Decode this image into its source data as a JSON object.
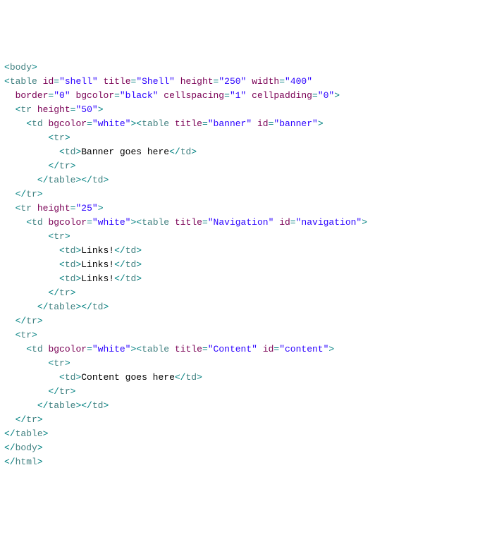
{
  "lines": [
    {
      "indent": 0,
      "parts": [
        {
          "t": "tag",
          "v": "<"
        },
        {
          "t": "elem",
          "v": "body"
        },
        {
          "t": "tag",
          "v": ">"
        }
      ]
    },
    {
      "indent": 0,
      "parts": [
        {
          "t": "tag",
          "v": "<"
        },
        {
          "t": "elem",
          "v": "table"
        },
        {
          "t": "text",
          "v": " "
        },
        {
          "t": "attr",
          "v": "id"
        },
        {
          "t": "tag",
          "v": "="
        },
        {
          "t": "val",
          "v": "\"shell\""
        },
        {
          "t": "text",
          "v": " "
        },
        {
          "t": "attr",
          "v": "title"
        },
        {
          "t": "tag",
          "v": "="
        },
        {
          "t": "val",
          "v": "\"Shell\""
        },
        {
          "t": "text",
          "v": " "
        },
        {
          "t": "attr",
          "v": "height"
        },
        {
          "t": "tag",
          "v": "="
        },
        {
          "t": "val",
          "v": "\"250\""
        },
        {
          "t": "text",
          "v": " "
        },
        {
          "t": "attr",
          "v": "width"
        },
        {
          "t": "tag",
          "v": "="
        },
        {
          "t": "val",
          "v": "\"400\""
        }
      ]
    },
    {
      "indent": 2,
      "parts": [
        {
          "t": "attr",
          "v": "border"
        },
        {
          "t": "tag",
          "v": "="
        },
        {
          "t": "val",
          "v": "\"0\""
        },
        {
          "t": "text",
          "v": " "
        },
        {
          "t": "attr",
          "v": "bgcolor"
        },
        {
          "t": "tag",
          "v": "="
        },
        {
          "t": "val",
          "v": "\"black\""
        },
        {
          "t": "text",
          "v": " "
        },
        {
          "t": "attr",
          "v": "cellspacing"
        },
        {
          "t": "tag",
          "v": "="
        },
        {
          "t": "val",
          "v": "\"1\""
        },
        {
          "t": "text",
          "v": " "
        },
        {
          "t": "attr",
          "v": "cellpadding"
        },
        {
          "t": "tag",
          "v": "="
        },
        {
          "t": "val",
          "v": "\"0\""
        },
        {
          "t": "tag",
          "v": ">"
        }
      ]
    },
    {
      "indent": 2,
      "parts": [
        {
          "t": "tag",
          "v": "<"
        },
        {
          "t": "elem",
          "v": "tr"
        },
        {
          "t": "text",
          "v": " "
        },
        {
          "t": "attr",
          "v": "height"
        },
        {
          "t": "tag",
          "v": "="
        },
        {
          "t": "val",
          "v": "\"50\""
        },
        {
          "t": "tag",
          "v": ">"
        }
      ]
    },
    {
      "indent": 4,
      "parts": [
        {
          "t": "tag",
          "v": "<"
        },
        {
          "t": "elem",
          "v": "td"
        },
        {
          "t": "text",
          "v": " "
        },
        {
          "t": "attr",
          "v": "bgcolor"
        },
        {
          "t": "tag",
          "v": "="
        },
        {
          "t": "val",
          "v": "\"white\""
        },
        {
          "t": "tag",
          "v": "><"
        },
        {
          "t": "elem",
          "v": "table"
        },
        {
          "t": "text",
          "v": " "
        },
        {
          "t": "attr",
          "v": "title"
        },
        {
          "t": "tag",
          "v": "="
        },
        {
          "t": "val",
          "v": "\"banner\""
        },
        {
          "t": "text",
          "v": " "
        },
        {
          "t": "attr",
          "v": "id"
        },
        {
          "t": "tag",
          "v": "="
        },
        {
          "t": "val",
          "v": "\"banner\""
        },
        {
          "t": "tag",
          "v": ">"
        }
      ]
    },
    {
      "indent": 8,
      "parts": [
        {
          "t": "tag",
          "v": "<"
        },
        {
          "t": "elem",
          "v": "tr"
        },
        {
          "t": "tag",
          "v": ">"
        }
      ]
    },
    {
      "indent": 10,
      "parts": [
        {
          "t": "tag",
          "v": "<"
        },
        {
          "t": "elem",
          "v": "td"
        },
        {
          "t": "tag",
          "v": ">"
        },
        {
          "t": "text",
          "v": "Banner goes here"
        },
        {
          "t": "tag",
          "v": "</"
        },
        {
          "t": "elem",
          "v": "td"
        },
        {
          "t": "tag",
          "v": ">"
        }
      ]
    },
    {
      "indent": 8,
      "parts": [
        {
          "t": "tag",
          "v": "</"
        },
        {
          "t": "elem",
          "v": "tr"
        },
        {
          "t": "tag",
          "v": ">"
        }
      ]
    },
    {
      "indent": 6,
      "parts": [
        {
          "t": "tag",
          "v": "</"
        },
        {
          "t": "elem",
          "v": "table"
        },
        {
          "t": "tag",
          "v": "></"
        },
        {
          "t": "elem",
          "v": "td"
        },
        {
          "t": "tag",
          "v": ">"
        }
      ]
    },
    {
      "indent": 2,
      "parts": [
        {
          "t": "tag",
          "v": "</"
        },
        {
          "t": "elem",
          "v": "tr"
        },
        {
          "t": "tag",
          "v": ">"
        }
      ]
    },
    {
      "indent": 2,
      "parts": [
        {
          "t": "tag",
          "v": "<"
        },
        {
          "t": "elem",
          "v": "tr"
        },
        {
          "t": "text",
          "v": " "
        },
        {
          "t": "attr",
          "v": "height"
        },
        {
          "t": "tag",
          "v": "="
        },
        {
          "t": "val",
          "v": "\"25\""
        },
        {
          "t": "tag",
          "v": ">"
        }
      ]
    },
    {
      "indent": 4,
      "parts": [
        {
          "t": "tag",
          "v": "<"
        },
        {
          "t": "elem",
          "v": "td"
        },
        {
          "t": "text",
          "v": " "
        },
        {
          "t": "attr",
          "v": "bgcolor"
        },
        {
          "t": "tag",
          "v": "="
        },
        {
          "t": "val",
          "v": "\"white\""
        },
        {
          "t": "tag",
          "v": "><"
        },
        {
          "t": "elem",
          "v": "table"
        },
        {
          "t": "text",
          "v": " "
        },
        {
          "t": "attr",
          "v": "title"
        },
        {
          "t": "tag",
          "v": "="
        },
        {
          "t": "val",
          "v": "\"Navigation\""
        },
        {
          "t": "text",
          "v": " "
        },
        {
          "t": "attr",
          "v": "id"
        },
        {
          "t": "tag",
          "v": "="
        },
        {
          "t": "val",
          "v": "\"navigation\""
        },
        {
          "t": "tag",
          "v": ">"
        }
      ]
    },
    {
      "indent": 8,
      "parts": [
        {
          "t": "tag",
          "v": "<"
        },
        {
          "t": "elem",
          "v": "tr"
        },
        {
          "t": "tag",
          "v": ">"
        }
      ]
    },
    {
      "indent": 10,
      "parts": [
        {
          "t": "tag",
          "v": "<"
        },
        {
          "t": "elem",
          "v": "td"
        },
        {
          "t": "tag",
          "v": ">"
        },
        {
          "t": "text",
          "v": "Links!"
        },
        {
          "t": "tag",
          "v": "</"
        },
        {
          "t": "elem",
          "v": "td"
        },
        {
          "t": "tag",
          "v": ">"
        }
      ]
    },
    {
      "indent": 10,
      "parts": [
        {
          "t": "tag",
          "v": "<"
        },
        {
          "t": "elem",
          "v": "td"
        },
        {
          "t": "tag",
          "v": ">"
        },
        {
          "t": "text",
          "v": "Links!"
        },
        {
          "t": "tag",
          "v": "</"
        },
        {
          "t": "elem",
          "v": "td"
        },
        {
          "t": "tag",
          "v": ">"
        }
      ]
    },
    {
      "indent": 10,
      "parts": [
        {
          "t": "tag",
          "v": "<"
        },
        {
          "t": "elem",
          "v": "td"
        },
        {
          "t": "tag",
          "v": ">"
        },
        {
          "t": "text",
          "v": "Links!"
        },
        {
          "t": "tag",
          "v": "</"
        },
        {
          "t": "elem",
          "v": "td"
        },
        {
          "t": "tag",
          "v": ">"
        }
      ]
    },
    {
      "indent": 8,
      "parts": [
        {
          "t": "tag",
          "v": "</"
        },
        {
          "t": "elem",
          "v": "tr"
        },
        {
          "t": "tag",
          "v": ">"
        }
      ]
    },
    {
      "indent": 6,
      "parts": [
        {
          "t": "tag",
          "v": "</"
        },
        {
          "t": "elem",
          "v": "table"
        },
        {
          "t": "tag",
          "v": "></"
        },
        {
          "t": "elem",
          "v": "td"
        },
        {
          "t": "tag",
          "v": ">"
        }
      ]
    },
    {
      "indent": 2,
      "parts": [
        {
          "t": "tag",
          "v": "</"
        },
        {
          "t": "elem",
          "v": "tr"
        },
        {
          "t": "tag",
          "v": ">"
        }
      ]
    },
    {
      "indent": 2,
      "parts": [
        {
          "t": "tag",
          "v": "<"
        },
        {
          "t": "elem",
          "v": "tr"
        },
        {
          "t": "tag",
          "v": ">"
        }
      ]
    },
    {
      "indent": 4,
      "parts": [
        {
          "t": "tag",
          "v": "<"
        },
        {
          "t": "elem",
          "v": "td"
        },
        {
          "t": "text",
          "v": " "
        },
        {
          "t": "attr",
          "v": "bgcolor"
        },
        {
          "t": "tag",
          "v": "="
        },
        {
          "t": "val",
          "v": "\"white\""
        },
        {
          "t": "tag",
          "v": "><"
        },
        {
          "t": "elem",
          "v": "table"
        },
        {
          "t": "text",
          "v": " "
        },
        {
          "t": "attr",
          "v": "title"
        },
        {
          "t": "tag",
          "v": "="
        },
        {
          "t": "val",
          "v": "\"Content\""
        },
        {
          "t": "text",
          "v": " "
        },
        {
          "t": "attr",
          "v": "id"
        },
        {
          "t": "tag",
          "v": "="
        },
        {
          "t": "val",
          "v": "\"content\""
        },
        {
          "t": "tag",
          "v": ">"
        }
      ]
    },
    {
      "indent": 8,
      "parts": [
        {
          "t": "tag",
          "v": "<"
        },
        {
          "t": "elem",
          "v": "tr"
        },
        {
          "t": "tag",
          "v": ">"
        }
      ]
    },
    {
      "indent": 10,
      "parts": [
        {
          "t": "tag",
          "v": "<"
        },
        {
          "t": "elem",
          "v": "td"
        },
        {
          "t": "tag",
          "v": ">"
        },
        {
          "t": "text",
          "v": "Content goes here"
        },
        {
          "t": "tag",
          "v": "</"
        },
        {
          "t": "elem",
          "v": "td"
        },
        {
          "t": "tag",
          "v": ">"
        }
      ]
    },
    {
      "indent": 8,
      "parts": [
        {
          "t": "tag",
          "v": "</"
        },
        {
          "t": "elem",
          "v": "tr"
        },
        {
          "t": "tag",
          "v": ">"
        }
      ]
    },
    {
      "indent": 6,
      "parts": [
        {
          "t": "tag",
          "v": "</"
        },
        {
          "t": "elem",
          "v": "table"
        },
        {
          "t": "tag",
          "v": "></"
        },
        {
          "t": "elem",
          "v": "td"
        },
        {
          "t": "tag",
          "v": ">"
        }
      ]
    },
    {
      "indent": 2,
      "parts": [
        {
          "t": "tag",
          "v": "</"
        },
        {
          "t": "elem",
          "v": "tr"
        },
        {
          "t": "tag",
          "v": ">"
        }
      ]
    },
    {
      "indent": 0,
      "parts": [
        {
          "t": "tag",
          "v": "</"
        },
        {
          "t": "elem",
          "v": "table"
        },
        {
          "t": "tag",
          "v": ">"
        }
      ]
    },
    {
      "indent": 0,
      "parts": [
        {
          "t": "tag",
          "v": "</"
        },
        {
          "t": "elem",
          "v": "body"
        },
        {
          "t": "tag",
          "v": ">"
        }
      ]
    },
    {
      "indent": 0,
      "parts": [
        {
          "t": "tag",
          "v": "</"
        },
        {
          "t": "elem",
          "v": "html"
        },
        {
          "t": "tag",
          "v": ">"
        }
      ]
    }
  ]
}
